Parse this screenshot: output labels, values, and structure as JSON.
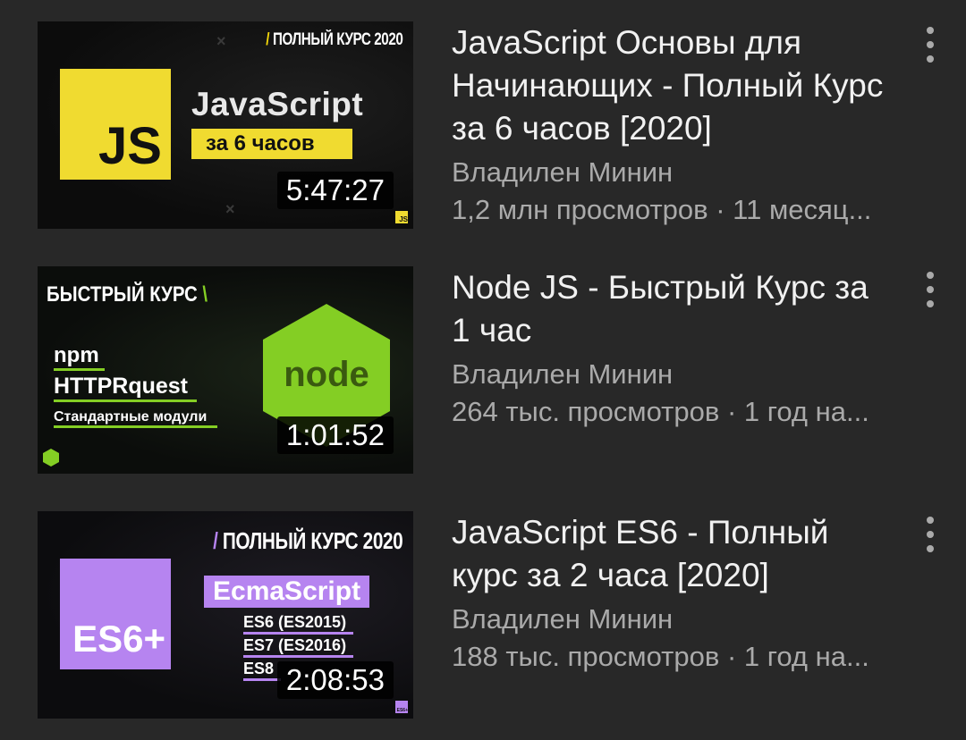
{
  "videos": [
    {
      "title": "JavaScript Основы для Начинающих - Полный Курс за 6 часов [2020]",
      "channel": "Владилен Минин",
      "meta": "1,2 млн просмотров · 11 месяц...",
      "duration": "5:47:27",
      "thumb": {
        "badge": "ПОЛНЫЙ КУРС 2020",
        "logo_text": "JS",
        "headline": "JavaScript",
        "subline": "за 6 часов",
        "corner": "JS"
      }
    },
    {
      "title": "Node JS - Быстрый Курс за 1 час",
      "channel": "Владилен Минин",
      "meta": "264 тыс. просмотров · 1 год на...",
      "duration": "1:01:52",
      "thumb": {
        "badge": "БЫСТРЫЙ КУРС",
        "logo_text": "node",
        "line1": "npm",
        "line2": "HTTPRquest",
        "line3": "Стандартные модули"
      }
    },
    {
      "title": "JavaScript ES6 - Полный курс за 2 часа [2020]",
      "channel": "Владилен Минин",
      "meta": "188 тыс. просмотров · 1 год на...",
      "duration": "2:08:53",
      "thumb": {
        "badge": "ПОЛНЫЙ КУРС 2020",
        "logo_text": "ES6+",
        "headline": "EcmaScript",
        "line1": "ES6 (ES2015)",
        "line2": "ES7 (ES2016)",
        "line3": "ES8",
        "corner": "ES6+"
      }
    }
  ],
  "colors": {
    "background": "#282828",
    "js_yellow": "#f0db30",
    "node_green": "#84ce24",
    "es_purple": "#b684f0",
    "secondary_text": "#aaaaaa"
  },
  "icons": {
    "more": "more-vert-icon"
  }
}
